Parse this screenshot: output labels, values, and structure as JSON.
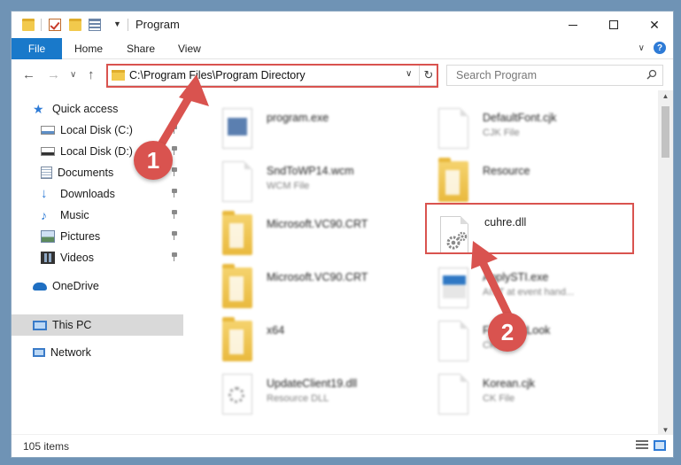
{
  "window": {
    "title": "Program",
    "minimize_glyph": "—",
    "maximize_glyph": "☐",
    "close_glyph": "✕"
  },
  "ribbon": {
    "tabs": [
      "File",
      "Home",
      "Share",
      "View"
    ],
    "collapse_glyph": "∨",
    "help_glyph": "?"
  },
  "address": {
    "back_glyph": "←",
    "forward_glyph": "→",
    "recent_glyph": "∨",
    "up_glyph": "↑",
    "path": "C:\\Program Files\\Program Directory",
    "refresh_glyph": "↻",
    "search_placeholder": "Search Program"
  },
  "nav": {
    "items": [
      {
        "label": "Quick access",
        "icon": "star-icon"
      },
      {
        "label": "Local Disk (C:)",
        "icon": "drive-icon",
        "pinned": true
      },
      {
        "label": "Local Disk (D:)",
        "icon": "drive-icon",
        "pinned": true
      },
      {
        "label": "Documents",
        "icon": "documents-icon",
        "pinned": true
      },
      {
        "label": "Downloads",
        "icon": "download-icon",
        "pinned": true
      },
      {
        "label": "Music",
        "icon": "music-icon",
        "pinned": true
      },
      {
        "label": "Pictures",
        "icon": "pictures-icon",
        "pinned": true
      },
      {
        "label": "Videos",
        "icon": "videos-icon",
        "pinned": true
      },
      {
        "label": "OneDrive",
        "icon": "cloud-icon"
      },
      {
        "label": "This PC",
        "icon": "computer-icon",
        "selected": true
      },
      {
        "label": "Network",
        "icon": "network-icon"
      }
    ]
  },
  "files": [
    {
      "name": "program.exe",
      "type": "",
      "icon": "exe-icon",
      "blurred": true
    },
    {
      "name": "DefaultFont.cjk",
      "type": "CJK File",
      "icon": "document-icon",
      "blurred": true
    },
    {
      "name": "SndToWP14.wcm",
      "type": "WCM File",
      "icon": "document-icon",
      "blurred": true
    },
    {
      "name": "Resource",
      "type": "",
      "icon": "folder-icon",
      "blurred": true
    },
    {
      "name": "Microsoft.VC90.CRT",
      "type": "",
      "icon": "folder-icon",
      "blurred": true
    },
    {
      "name": "cuhre.dll",
      "type": "",
      "icon": "dll-gear-icon",
      "blurred": false,
      "highlighted": true
    },
    {
      "name": "Microsoft.VC90.CRT",
      "type": "",
      "icon": "folder-icon",
      "blurred": true
    },
    {
      "name": "ApplySTI.exe",
      "type": "AIST at event hand...",
      "icon": "app-icon",
      "blurred": true
    },
    {
      "name": "x64",
      "type": "",
      "icon": "folder-icon",
      "blurred": true
    },
    {
      "name": "FastFontLook",
      "type": "CK File",
      "icon": "document-icon",
      "blurred": true
    },
    {
      "name": "UpdateClient19.dll",
      "type": "Resource DLL",
      "icon": "dll-icon",
      "blurred": true
    },
    {
      "name": "Korean.cjk",
      "type": "CK File",
      "icon": "document-icon",
      "blurred": true
    }
  ],
  "status": {
    "item_count": "105 items"
  },
  "annotations": {
    "step1": "1",
    "step2": "2",
    "highlight_color": "#d9534f"
  },
  "colors": {
    "accent": "#1979ca",
    "folder": "#f2c94c"
  }
}
